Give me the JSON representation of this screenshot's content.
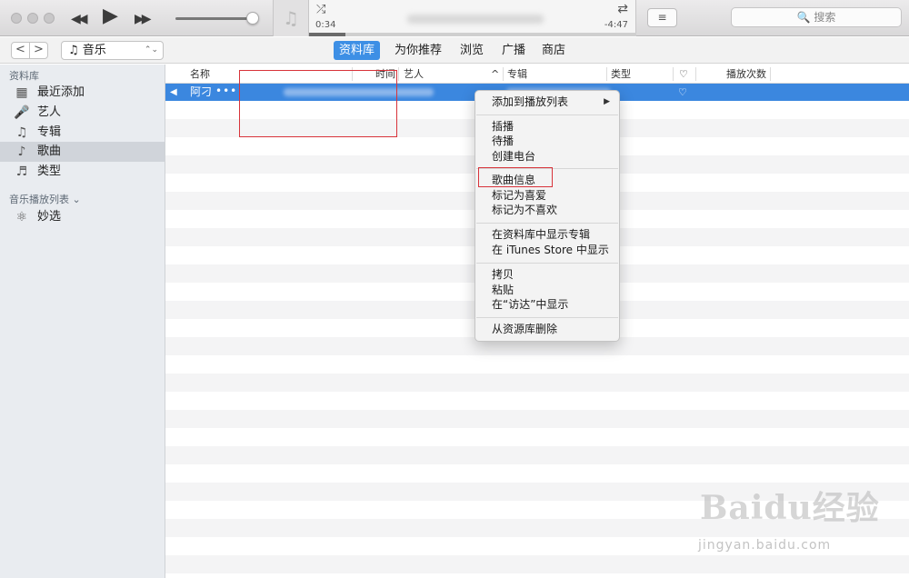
{
  "titlebar": {
    "controls": {
      "prev_icon": "◀◀",
      "play_icon": "▶",
      "next_icon": "▶▶"
    },
    "now_playing": {
      "shuffle_icon": "⤮",
      "repeat_icon": "⇄",
      "elapsed": "0:34",
      "remaining": "-4:47",
      "progress_fraction": 0.11
    },
    "list_button_icon": "≡",
    "search": {
      "placeholder": "🔍 搜索"
    }
  },
  "navbar": {
    "back_icon": "<",
    "forward_icon": ">",
    "media_selector": "♫ 音乐",
    "media_arrows": "⌃⌄",
    "tabs": [
      {
        "label": "资料库",
        "active": true
      },
      {
        "label": "为你推荐",
        "active": false
      },
      {
        "label": "浏览",
        "active": false
      },
      {
        "label": "广播",
        "active": false
      },
      {
        "label": "商店",
        "active": false
      }
    ]
  },
  "sidebar": {
    "library_header": "资料库",
    "items": [
      {
        "label": "最近添加",
        "icon": "▦",
        "selected": false
      },
      {
        "label": "艺人",
        "icon": "🎤",
        "selected": false
      },
      {
        "label": "专辑",
        "icon": "♫",
        "selected": false
      },
      {
        "label": "歌曲",
        "icon": "♪",
        "selected": true
      },
      {
        "label": "类型",
        "icon": "♬",
        "selected": false
      }
    ],
    "playlists_header": "音乐播放列表 ⌄",
    "playlists": [
      {
        "label": "妙选",
        "icon": "⚛"
      }
    ]
  },
  "table": {
    "columns": {
      "name": "名称",
      "time": "时间",
      "artist": "艺人",
      "sort_icon": "^",
      "album": "专辑",
      "genre": "类型",
      "love": "♡",
      "plays": "播放次数"
    },
    "selected_row": {
      "speaker_icon": "◀",
      "name": "阿刁",
      "more": "•••",
      "love": "♡"
    }
  },
  "context_menu": {
    "items": [
      {
        "label": "添加到播放列表",
        "submenu": "▶"
      },
      {
        "label": "插播"
      },
      {
        "label": "待播"
      },
      {
        "label": "创建电台"
      },
      {
        "label": "歌曲信息"
      },
      {
        "label": "标记为喜爱"
      },
      {
        "label": "标记为不喜欢"
      },
      {
        "label": "在资料库中显示专辑"
      },
      {
        "label": "在 iTunes Store 中显示"
      },
      {
        "label": "拷贝"
      },
      {
        "label": "粘贴"
      },
      {
        "label": "在“访达”中显示"
      },
      {
        "label": "从资源库删除"
      }
    ]
  },
  "watermark": {
    "brand": "Baidu经验",
    "url": "jingyan.baidu.com"
  }
}
